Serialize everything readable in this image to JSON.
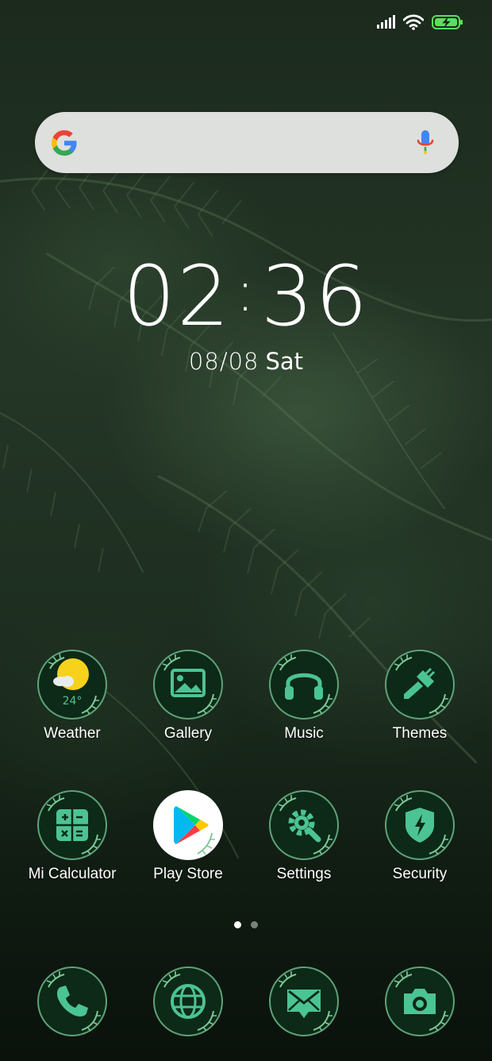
{
  "status_bar": {
    "signal_icon": "signal-bars-icon",
    "wifi_icon": "wifi-icon",
    "battery_icon": "battery-charging-icon",
    "battery_color": "#5be05a"
  },
  "search": {
    "logo_icon": "google-g-icon",
    "mic_icon": "microphone-icon"
  },
  "clock": {
    "hours": "02",
    "minutes": "36",
    "date": "08/08",
    "day": "Sat"
  },
  "apps": [
    {
      "label": "Weather",
      "icon": "weather-icon",
      "badge": "24°"
    },
    {
      "label": "Gallery",
      "icon": "gallery-icon"
    },
    {
      "label": "Music",
      "icon": "headphones-icon"
    },
    {
      "label": "Themes",
      "icon": "paintbrush-icon"
    },
    {
      "label": "Mi Calculator",
      "icon": "calculator-icon"
    },
    {
      "label": "Play Store",
      "icon": "play-store-icon"
    },
    {
      "label": "Settings",
      "icon": "settings-gear-icon"
    },
    {
      "label": "Security",
      "icon": "shield-icon"
    }
  ],
  "page_indicator": {
    "pages": 2,
    "current": 1
  },
  "dock": [
    {
      "icon": "phone-icon"
    },
    {
      "icon": "browser-globe-icon"
    },
    {
      "icon": "messaging-icon"
    },
    {
      "icon": "camera-icon"
    }
  ],
  "colors": {
    "icon_bg": "#0c2a17",
    "icon_ring": "#5fa27a",
    "icon_glyph": "#4cc394",
    "weather_sun": "#f7d21c"
  }
}
